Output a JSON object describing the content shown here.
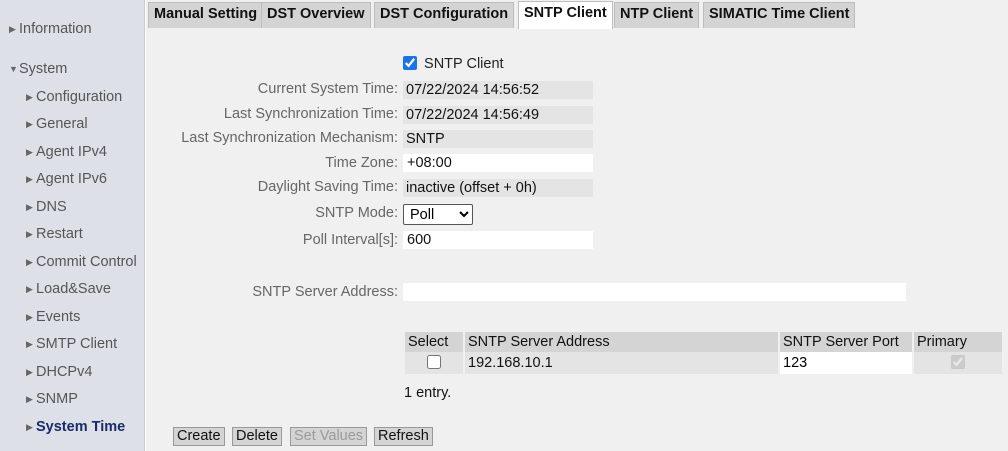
{
  "sidebar": {
    "items": [
      {
        "label": "Information",
        "icon": "triangle-right"
      },
      {
        "label": "System",
        "icon": "triangle-down"
      },
      {
        "label": "Configuration",
        "icon": "triangle-right"
      },
      {
        "label": "General",
        "icon": "triangle-right"
      },
      {
        "label": "Agent IPv4",
        "icon": "triangle-right"
      },
      {
        "label": "Agent IPv6",
        "icon": "triangle-right"
      },
      {
        "label": "DNS",
        "icon": "triangle-right"
      },
      {
        "label": "Restart",
        "icon": "triangle-right"
      },
      {
        "label": "Commit Control",
        "icon": "triangle-right"
      },
      {
        "label": "Load&Save",
        "icon": "triangle-right"
      },
      {
        "label": "Events",
        "icon": "triangle-right"
      },
      {
        "label": "SMTP Client",
        "icon": "triangle-right"
      },
      {
        "label": "DHCPv4",
        "icon": "triangle-right"
      },
      {
        "label": "SNMP",
        "icon": "triangle-right"
      },
      {
        "label": "System Time",
        "icon": "triangle-right"
      }
    ]
  },
  "tabs": [
    {
      "label": "Manual Setting"
    },
    {
      "label": "DST Overview"
    },
    {
      "label": "DST Configuration"
    },
    {
      "label": "SNTP Client",
      "active": true
    },
    {
      "label": "NTP Client"
    },
    {
      "label": "SIMATIC Time Client"
    }
  ],
  "form": {
    "sntp_client_label": "SNTP Client",
    "sntp_client_checked": true,
    "current_time_label": "Current System Time:",
    "current_time_value": "07/22/2024 14:56:52",
    "last_sync_label": "Last Synchronization Time:",
    "last_sync_value": "07/22/2024 14:56:49",
    "last_mech_label": "Last Synchronization Mechanism:",
    "last_mech_value": "SNTP",
    "time_zone_label": "Time Zone:",
    "time_zone_value": "+08:00",
    "dst_label": "Daylight Saving Time:",
    "dst_value": "inactive (offset + 0h)",
    "mode_label": "SNTP Mode:",
    "mode_value": "Poll",
    "poll_label": "Poll Interval[s]:",
    "poll_value": "600",
    "server_addr_label": "SNTP Server Address:",
    "server_addr_value": ""
  },
  "table": {
    "headers": [
      "Select",
      "SNTP Server Address",
      "SNTP Server Port",
      "Primary"
    ],
    "rows": [
      {
        "select": false,
        "address": "192.168.10.1",
        "port": "123",
        "primary": true
      }
    ],
    "entry_note": "1 entry."
  },
  "buttons": {
    "create": "Create",
    "delete": "Delete",
    "set_values": "Set Values",
    "refresh": "Refresh"
  },
  "colors": {
    "sidebar_bg": "#dde1e7",
    "main_bg": "#f0f0f0",
    "active_nav": "#1b2a6b",
    "checkbox_accent": "#1a73e8"
  }
}
